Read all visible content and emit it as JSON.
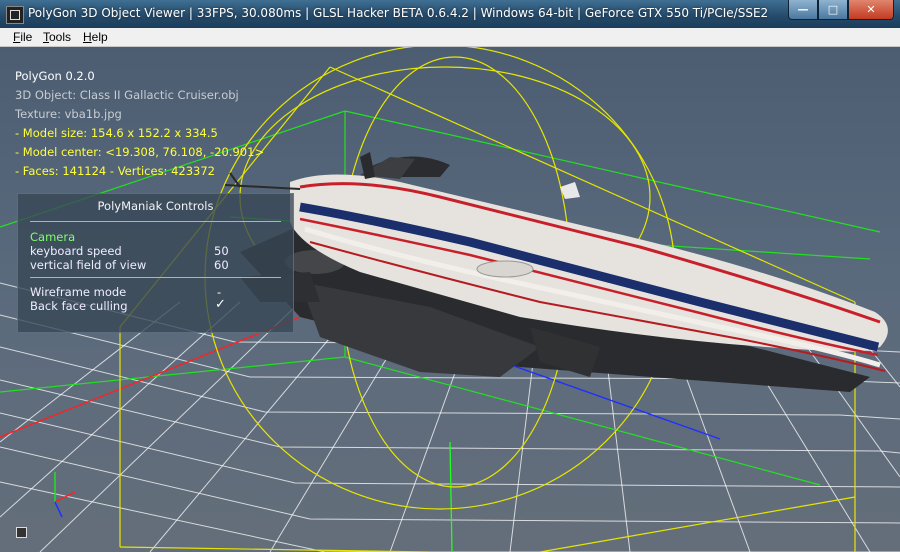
{
  "window": {
    "title": "PolyGon 3D Object Viewer | 33FPS, 30.080ms | GLSL Hacker BETA 0.6.4.2 | Windows 64-bit | GeForce GTX 550 Ti/PCIe/SSE2",
    "minimize_label": "—",
    "maximize_label": "□",
    "close_label": "✕"
  },
  "menu": {
    "file": "File",
    "tools": "Tools",
    "help": "Help"
  },
  "overlay": {
    "app_version": "PolyGon 0.2.0",
    "object": "3D Object: Class II Gallactic Cruiser.obj",
    "texture": "Texture: vba1b.jpg",
    "model_size": "- Model size:  154.6 x 152.2 x 334.5",
    "model_center": "- Model center:  <19.308, 76.108, -20.901>",
    "faces_vertices": "- Faces: 141124 - Vertices: 423372"
  },
  "controls": {
    "title": "PolyManiak Controls",
    "camera_header": "Camera",
    "keyboard_speed_label": "keyboard speed",
    "keyboard_speed_value": "50",
    "fov_label": "vertical field of view",
    "fov_value": "60",
    "wireframe_label": "Wireframe mode",
    "wireframe_value": "-",
    "backface_label": "Back face culling",
    "backface_value": "✓"
  },
  "colors": {
    "bounding_box": "#e6e600",
    "grid": "#ffffff",
    "axis_x": "#ff2020",
    "axis_y": "#20ff20",
    "axis_z": "#2030ff",
    "info_yellow": "#ffff3a",
    "camera_green": "#7cff6c"
  }
}
